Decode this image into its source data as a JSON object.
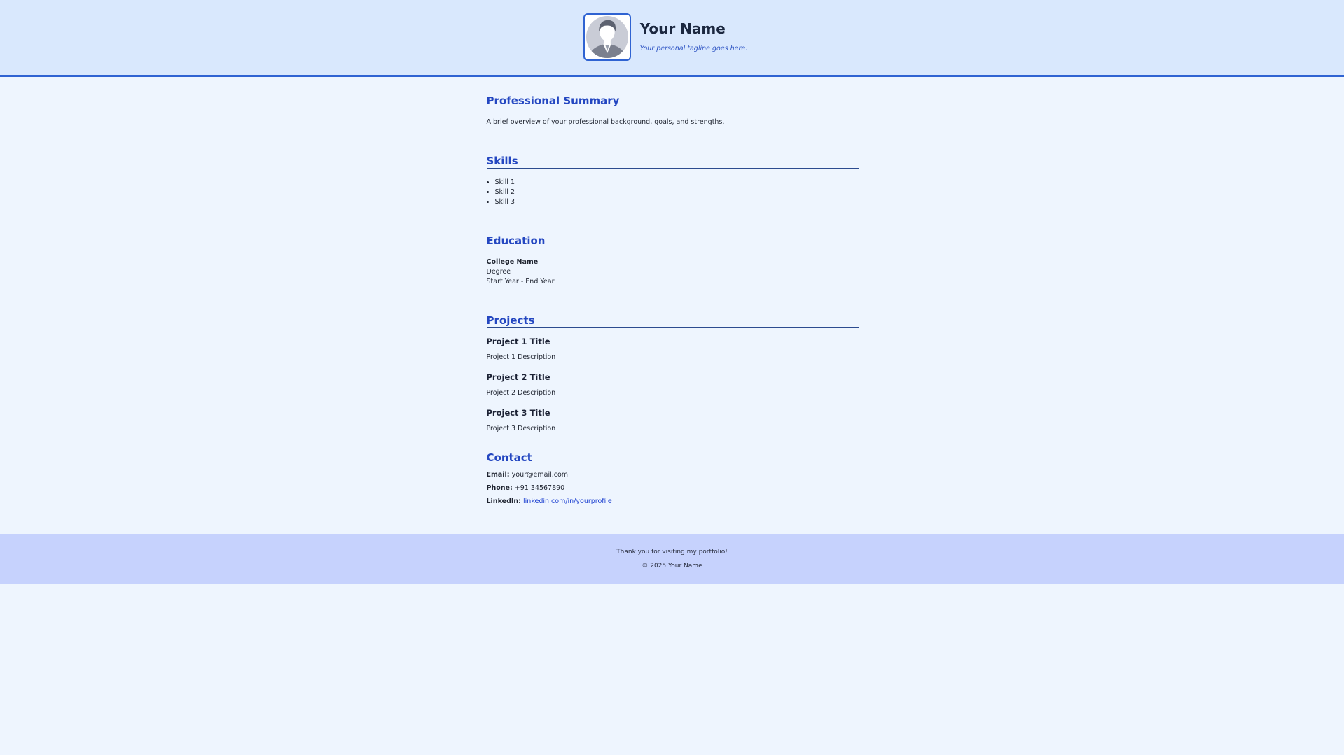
{
  "header": {
    "avatar_icon": "person-avatar-icon",
    "name": "Your Name",
    "tagline": "Your personal tagline goes here."
  },
  "summary": {
    "heading": "Professional Summary",
    "text": "A brief overview of your professional background, goals, and strengths."
  },
  "skills": {
    "heading": "Skills",
    "items": [
      "Skill 1",
      "Skill 2",
      "Skill 3"
    ]
  },
  "education": {
    "heading": "Education",
    "college": "College Name",
    "degree": "Degree",
    "years": "Start Year - End Year"
  },
  "projects": {
    "heading": "Projects",
    "items": [
      {
        "title": "Project 1 Title",
        "description": "Project 1 Description"
      },
      {
        "title": "Project 2 Title",
        "description": "Project 2 Description"
      },
      {
        "title": "Project 3 Title",
        "description": "Project 3 Description"
      }
    ]
  },
  "contact": {
    "heading": "Contact",
    "email_label": "Email:",
    "email_value": "your@email.com",
    "phone_label": "Phone:",
    "phone_value": "+91 34567890",
    "linkedin_label": "LinkedIn:",
    "linkedin_value": "linkedin.com/in/yourprofile"
  },
  "footer": {
    "thanks": "Thank you for visiting my portfolio!",
    "copyright": "© 2025 Your Name"
  },
  "colors": {
    "accent": "#2447c1",
    "header_bg": "#d9e8fd",
    "page_bg": "#eef5fe",
    "footer_bg": "#c6d2fd"
  }
}
